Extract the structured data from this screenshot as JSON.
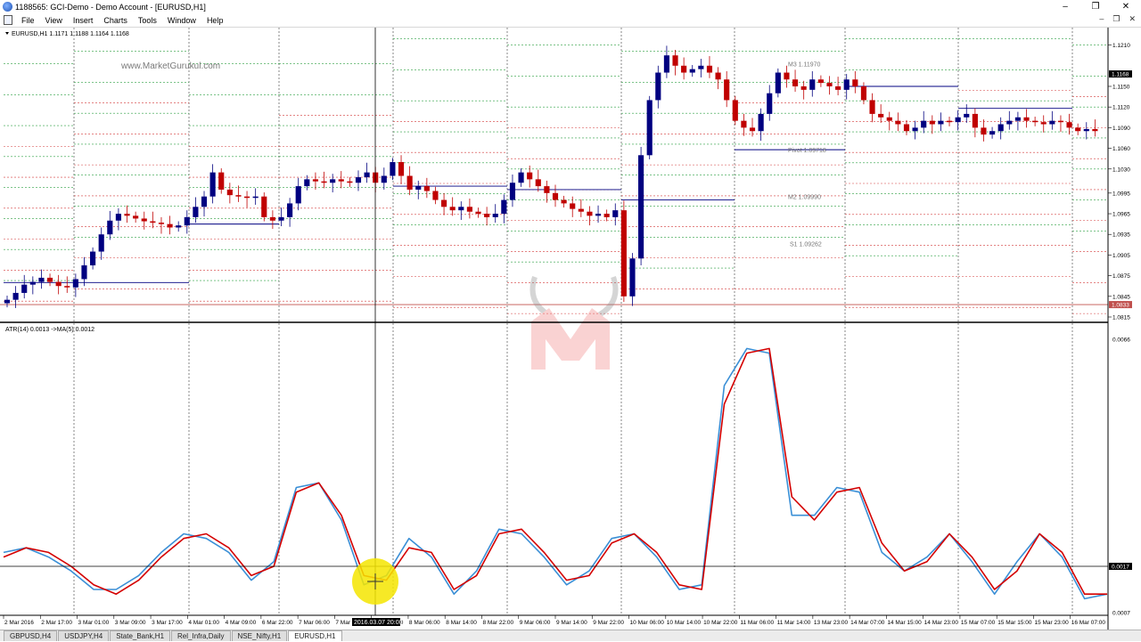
{
  "window": {
    "title": "1188565: GCI-Demo - Demo Account - [EURUSD,H1]"
  },
  "menu": [
    "File",
    "View",
    "Insert",
    "Charts",
    "Tools",
    "Window",
    "Help"
  ],
  "window_controls": {
    "minimize": "–",
    "restore": "❐",
    "close": "✕"
  },
  "mdi_controls": {
    "minimize": "–",
    "restore": "❐",
    "close": "✕"
  },
  "chart": {
    "symbol_label": "EURUSD,H1  1.1171 1.1188 1.1164 1.1168",
    "watermark": "www.MarketGurukul.com",
    "current_price_label": "1.1168",
    "low_line_label": "1.0833",
    "price_ticks": [
      "1.1210",
      "1.1150",
      "1.1120",
      "1.1090",
      "1.1060",
      "1.1030",
      "1.0995",
      "1.0965",
      "1.0935",
      "1.0905",
      "1.0875",
      "1.0845",
      "1.0815"
    ],
    "pivot_labels": [
      {
        "text": "M3 1.11970",
        "price": 1.1183
      },
      {
        "text": "Pivot 1.09718",
        "price": 1.1058
      },
      {
        "text": "M2 1.09990",
        "price": 1.099
      },
      {
        "text": "S1 1.09262",
        "price": 1.0922
      }
    ],
    "indicator_label": "ATR(14) 0.0013  ->MA(5) 0.0012",
    "indicator_ticks": [
      "0.0066",
      "0.0007"
    ],
    "indicator_level_label": "0.0017",
    "crosshair_time_label": "2016.03.07 20:00",
    "time_labels": [
      "2 Mar 2016",
      "2 Mar 17:00",
      "3 Mar 01:00",
      "3 Mar 09:00",
      "3 Mar 17:00",
      "4 Mar 01:00",
      "4 Mar 09:00",
      "6 Mar 22:00",
      "7 Mar 06:00",
      "7 Mar 14:00",
      "7 Mar 22:00",
      "8 Mar 06:00",
      "8 Mar 14:00",
      "8 Mar 22:00",
      "9 Mar 06:00",
      "9 Mar 14:00",
      "9 Mar 22:00",
      "10 Mar 06:00",
      "10 Mar 14:00",
      "10 Mar 22:00",
      "11 Mar 06:00",
      "11 Mar 14:00",
      "13 Mar 23:00",
      "14 Mar 07:00",
      "14 Mar 15:00",
      "14 Mar 23:00",
      "15 Mar 07:00",
      "15 Mar 15:00",
      "15 Mar 23:00",
      "16 Mar 07:00"
    ]
  },
  "tabs": [
    {
      "label": "GBPUSD,H4",
      "active": false
    },
    {
      "label": "USDJPY,H4",
      "active": false
    },
    {
      "label": "State_Bank,H1",
      "active": false
    },
    {
      "label": "Rel_Infra,Daily",
      "active": false
    },
    {
      "label": "NSE_Nifty,H1",
      "active": false
    },
    {
      "label": "EURUSD,H1",
      "active": true
    }
  ],
  "chart_data": {
    "type": "candlestick",
    "symbol": "EURUSD",
    "timeframe": "H1",
    "price_range": [
      1.0815,
      1.1225
    ],
    "price_close_path": [
      1.084,
      1.085,
      1.0862,
      1.0866,
      1.0872,
      1.0866,
      1.086,
      1.0858,
      1.087,
      1.089,
      1.091,
      1.0935,
      1.0955,
      1.0965,
      1.0962,
      1.0958,
      1.0954,
      1.0952,
      1.095,
      1.0945,
      1.0948,
      1.096,
      1.0975,
      1.099,
      1.1025,
      1.1,
      1.0992,
      1.099,
      1.0988,
      1.099,
      1.096,
      1.0955,
      1.096,
      1.098,
      1.1005,
      1.1015,
      1.1012,
      1.101,
      1.1015,
      1.1012,
      1.101,
      1.1018,
      1.1025,
      1.101,
      1.102,
      1.104,
      1.102,
      1.1,
      1.1005,
      1.0998,
      1.0985,
      1.0975,
      1.097,
      1.0975,
      1.0968,
      1.0965,
      1.096,
      1.0965,
      1.0985,
      1.101,
      1.1025,
      1.1015,
      1.1005,
      1.0995,
      1.0985,
      1.098,
      1.0972,
      1.0968,
      1.0962,
      1.0965,
      1.096,
      1.097,
      1.0845,
      1.09,
      1.105,
      1.113,
      1.117,
      1.1195,
      1.118,
      1.117,
      1.1175,
      1.118,
      1.117,
      1.116,
      1.113,
      1.11,
      1.109,
      1.1085,
      1.111,
      1.114,
      1.117,
      1.116,
      1.115,
      1.1145,
      1.116,
      1.1155,
      1.115,
      1.1145,
      1.116,
      1.115,
      1.113,
      1.111,
      1.1105,
      1.11,
      1.1095,
      1.1085,
      1.109,
      1.11,
      1.1095,
      1.11,
      1.1098,
      1.1105,
      1.111,
      1.109,
      1.108,
      1.1085,
      1.1095,
      1.11,
      1.1105,
      1.11,
      1.1098,
      1.1095,
      1.11,
      1.1098,
      1.109,
      1.1085,
      1.1088,
      1.1085
    ],
    "atr_range": [
      0.0007,
      0.0066
    ],
    "atr_series": [
      0.002,
      0.0021,
      0.0019,
      0.0016,
      0.0012,
      0.0012,
      0.0015,
      0.002,
      0.0024,
      0.0023,
      0.002,
      0.0014,
      0.0018,
      0.0034,
      0.0035,
      0.0027,
      0.0013,
      0.0015,
      0.0023,
      0.0019,
      0.0011,
      0.0016,
      0.0025,
      0.0024,
      0.0019,
      0.0013,
      0.0016,
      0.0023,
      0.0024,
      0.0019,
      0.0012,
      0.0013,
      0.0056,
      0.0064,
      0.0063,
      0.0028,
      0.0028,
      0.0034,
      0.0033,
      0.002,
      0.0016,
      0.0019,
      0.0024,
      0.0018,
      0.0011,
      0.0018,
      0.0024,
      0.0019,
      0.001,
      0.0011
    ],
    "ma_series": [
      0.0019,
      0.0021,
      0.002,
      0.0017,
      0.0013,
      0.0011,
      0.0014,
      0.0019,
      0.0023,
      0.0024,
      0.0021,
      0.0015,
      0.0017,
      0.0033,
      0.0035,
      0.0028,
      0.0015,
      0.0014,
      0.0021,
      0.002,
      0.0012,
      0.0015,
      0.0024,
      0.0025,
      0.002,
      0.0014,
      0.0015,
      0.0022,
      0.0024,
      0.002,
      0.0013,
      0.0012,
      0.0052,
      0.0063,
      0.0064,
      0.0032,
      0.0027,
      0.0033,
      0.0034,
      0.0022,
      0.0016,
      0.0018,
      0.0024,
      0.0019,
      0.0012,
      0.0016,
      0.0024,
      0.002,
      0.0011,
      0.0011
    ],
    "colors": {
      "bull": "#000080",
      "bear": "#c00000",
      "atr": "#3a8fd6",
      "ma": "#d40000",
      "pivot_green": "#2ea043",
      "pivot_red": "#d33b3b"
    }
  }
}
